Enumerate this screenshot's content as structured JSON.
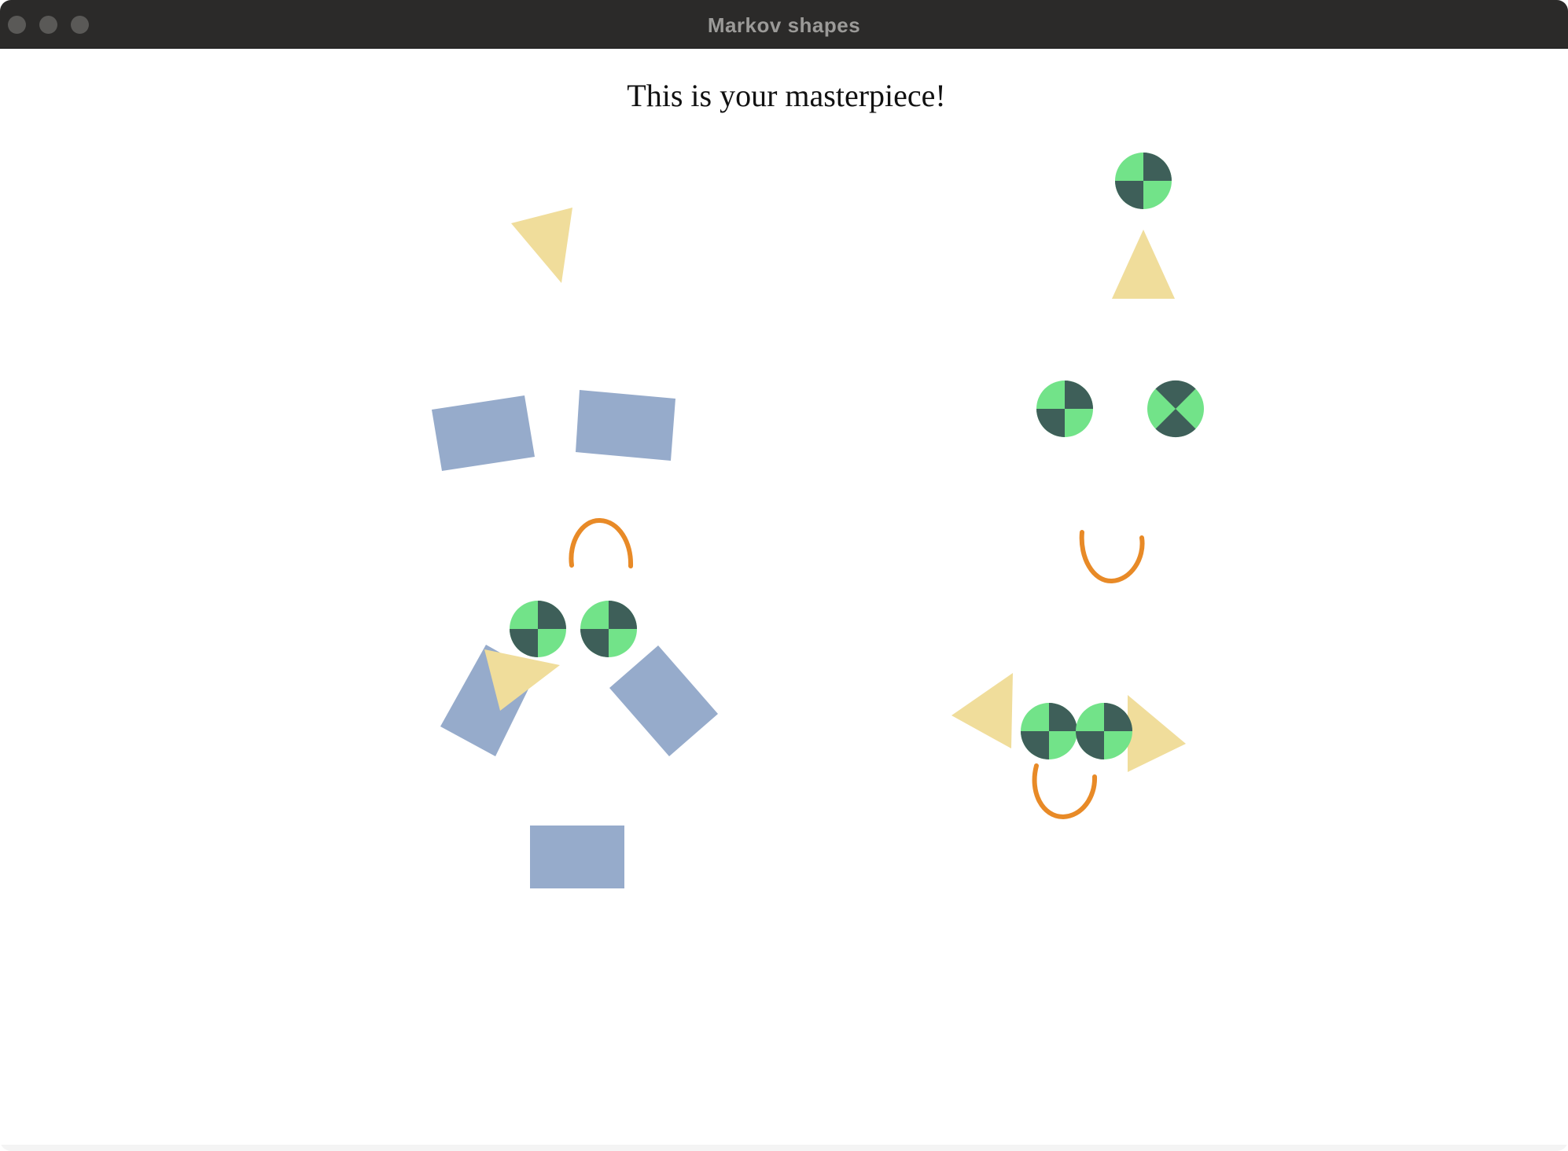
{
  "window": {
    "title": "Markov shapes"
  },
  "canvas": {
    "heading": "This is your masterpiece!"
  },
  "colors": {
    "rectangle": "#96abcb",
    "triangle": "#f0dd9b",
    "arc": "#e88a27",
    "circle_light": "#72e389",
    "circle_dark": "#3e5f59",
    "titlebar": "#2b2a29",
    "title_text": "#9b9a98"
  },
  "shapes": [
    "triangle",
    "rectangle",
    "rectangle",
    "arc",
    "circle-quartered",
    "circle-quartered",
    "rectangle",
    "triangle",
    "rectangle",
    "rectangle",
    "circle-quartered",
    "triangle",
    "circle-quartered",
    "circle-crossed",
    "arc",
    "triangle",
    "circle-quartered",
    "circle-quartered",
    "triangle",
    "arc"
  ]
}
